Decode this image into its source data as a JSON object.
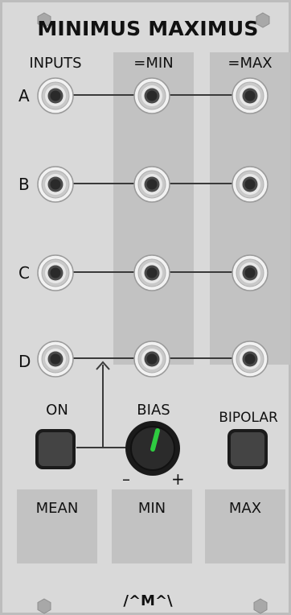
{
  "module": {
    "title": "MINIMUS MAXIMUS",
    "logo": "/^M^\\"
  },
  "columns": {
    "inputs": "INPUTS",
    "min": "=MIN",
    "max": "=MAX"
  },
  "rows": [
    "A",
    "B",
    "C",
    "D"
  ],
  "controls": {
    "on_label": "ON",
    "bias_label": "BIAS",
    "bias_minus": "–",
    "bias_plus": "+",
    "bipolar_label": "BIPOLAR"
  },
  "outputs": {
    "mean": "MEAN",
    "min": "MIN",
    "max": "MAX"
  },
  "colors": {
    "panel": "#d9d9d9",
    "shade": "#c2c2c2",
    "knob_indicator": "#2ecc40"
  }
}
